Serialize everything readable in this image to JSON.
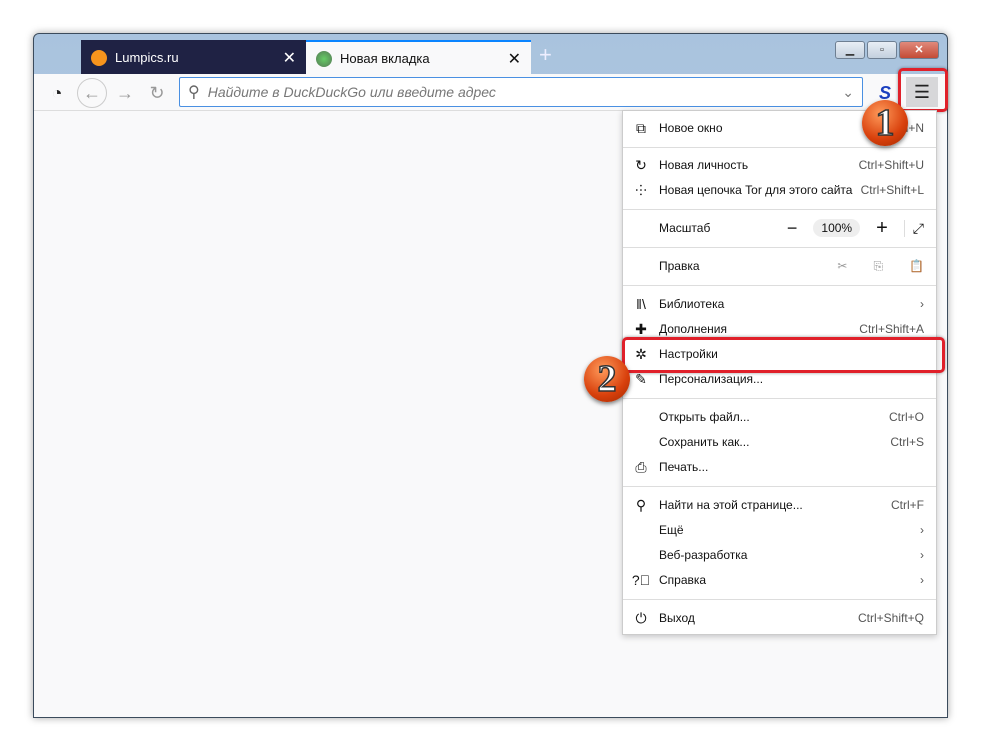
{
  "tabs": [
    {
      "title": "Lumpics.ru",
      "favicon": "orange-icon"
    },
    {
      "title": "Новая вкладка",
      "favicon": "globe-icon"
    }
  ],
  "toolbar": {
    "placeholder": "Найдите в DuckDuckGo или введите адрес"
  },
  "menu": {
    "new_window": {
      "label": "Новое окно",
      "shortcut": "Ctrl+N"
    },
    "new_identity": {
      "label": "Новая личность",
      "shortcut": "Ctrl+Shift+U"
    },
    "new_circuit": {
      "label": "Новая цепочка Tor для этого сайта",
      "shortcut": "Ctrl+Shift+L"
    },
    "zoom": {
      "label": "Масштаб",
      "minus": "−",
      "value": "100%",
      "plus": "+"
    },
    "edit": {
      "label": "Правка"
    },
    "library": {
      "label": "Библиотека"
    },
    "addons": {
      "label": "Дополнения",
      "shortcut": "Ctrl+Shift+A"
    },
    "settings": {
      "label": "Настройки"
    },
    "customize": {
      "label": "Персонализация..."
    },
    "open_file": {
      "label": "Открыть файл...",
      "shortcut": "Ctrl+O"
    },
    "save_as": {
      "label": "Сохранить как...",
      "shortcut": "Ctrl+S"
    },
    "print": {
      "label": "Печать..."
    },
    "find": {
      "label": "Найти на этой странице...",
      "shortcut": "Ctrl+F"
    },
    "more": {
      "label": "Ещё"
    },
    "webdev": {
      "label": "Веб-разработка"
    },
    "help": {
      "label": "Справка"
    },
    "quit": {
      "label": "Выход",
      "shortcut": "Ctrl+Shift+Q"
    }
  },
  "badges": [
    "1",
    "2"
  ],
  "colors": {
    "highlight": "#e0202a",
    "tab_dark": "#1f2244",
    "accent": "#0a84ff"
  }
}
